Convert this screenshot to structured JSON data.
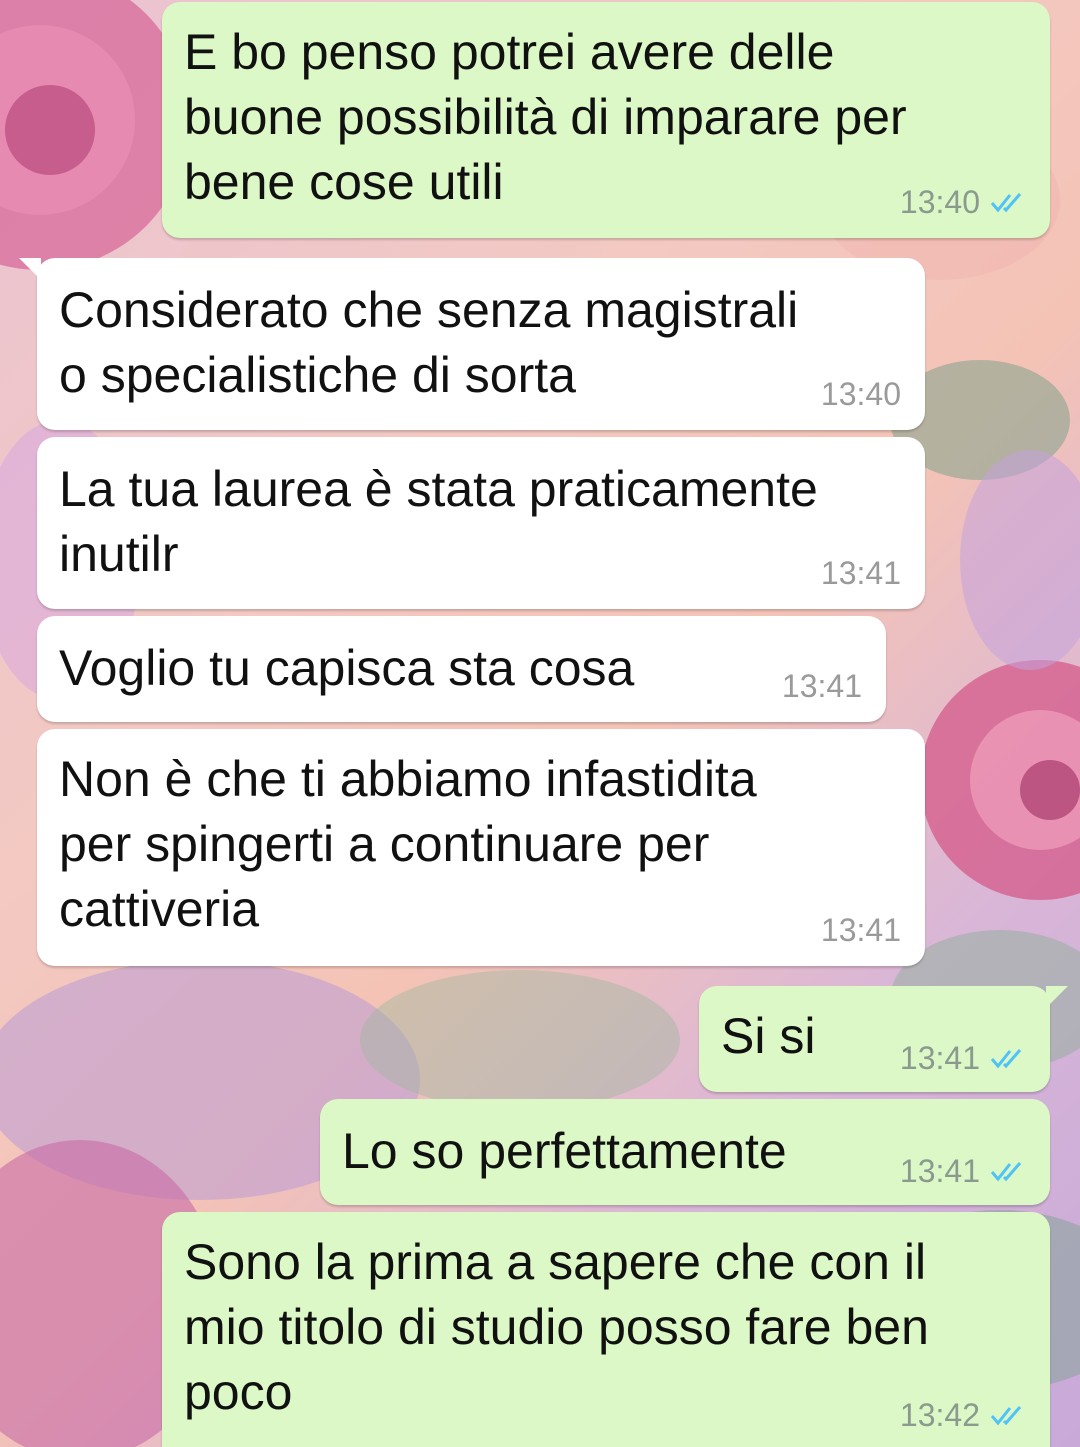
{
  "colors": {
    "outgoing_bubble": "#dcf8c6",
    "incoming_bubble": "#ffffff",
    "read_tick": "#4fc3f7"
  },
  "messages": [
    {
      "direction": "outgoing",
      "text": "E bo penso potrei avere delle\nbuone possibilità di imparare per\nbene cose utili",
      "time": "13:40",
      "status": "read-double-check-icon"
    },
    {
      "direction": "incoming",
      "text": "Considerato che senza magistrali\no specialistiche di sorta",
      "time": "13:40"
    },
    {
      "direction": "incoming",
      "text": "La tua laurea è stata praticamente\ninutilr",
      "time": "13:41"
    },
    {
      "direction": "incoming",
      "text": "Voglio tu capisca sta cosa",
      "time": "13:41"
    },
    {
      "direction": "incoming",
      "text": "Non è che ti abbiamo infastidita\nper spingerti a continuare per\ncattiveria",
      "time": "13:41"
    },
    {
      "direction": "outgoing",
      "text": "Si si",
      "time": "13:41",
      "status": "read-double-check-icon"
    },
    {
      "direction": "outgoing",
      "text": "Lo so perfettamente",
      "time": "13:41",
      "status": "read-double-check-icon"
    },
    {
      "direction": "outgoing",
      "text": "Sono la prima a sapere che con il\nmio titolo di studio posso fare ben\npoco",
      "time": "13:42",
      "status": "read-double-check-icon"
    }
  ]
}
